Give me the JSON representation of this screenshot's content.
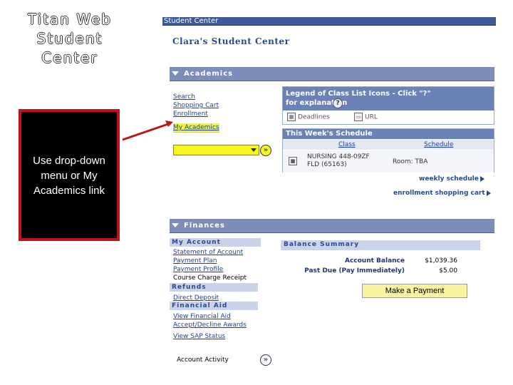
{
  "slide": {
    "title_line1": "Titan Web",
    "title_line2": "Student",
    "title_line3": "Center",
    "callout_text": "Use drop-down menu or My Academics link"
  },
  "header": {
    "title": "Student Center"
  },
  "page_title": "Clara's Student Center",
  "academics": {
    "section_label": "Academics",
    "links": [
      "Search",
      "Shopping Cart",
      "Enrollment",
      "My Academics"
    ],
    "dropdown_value": "",
    "go_icon": "double-chevron-right-icon",
    "legend": {
      "title": "Legend of Class List Icons - Click \"?\" for explanation",
      "help": "?",
      "deadlines_label": "Deadlines",
      "url_label": "URL"
    },
    "schedule": {
      "title": "This Week's Schedule",
      "col_class": "Class",
      "col_schedule": "Schedule",
      "class_line1": "NURSING 448-09ZF",
      "class_line2": "FLD (65163)",
      "schedule_value": "Room: TBA"
    },
    "weekly_schedule_link": "weekly schedule",
    "shopping_cart_link": "enrollment shopping cart"
  },
  "finances": {
    "section_label": "Finances",
    "my_account_label": "My Account",
    "account_links": [
      "Statement of Account",
      "Payment Plan",
      "Payment Profile"
    ],
    "course_charge_receipt": "Course Charge Receipt",
    "refunds_label": "Refunds",
    "refund_links": [
      "Direct Deposit"
    ],
    "financial_aid_label": "Financial Aid",
    "aid_links": [
      "View Financial Aid",
      "Accept/Decline Awards",
      "View SAP Status"
    ],
    "balance_summary": {
      "title": "Balance Summary",
      "account_balance_label": "Account Balance",
      "account_balance_value": "$1,039.36",
      "past_due_label": "Past Due (Pay Immediately)",
      "past_due_value": "$5.00"
    },
    "make_payment_label": "Make a Payment",
    "account_activity": "Account Activity"
  },
  "colors": {
    "header_blue": "#3c5a95",
    "section_bar": "#7b8db8",
    "highlight_yellow": "#f6f622",
    "callout_border": "#c0121b"
  }
}
